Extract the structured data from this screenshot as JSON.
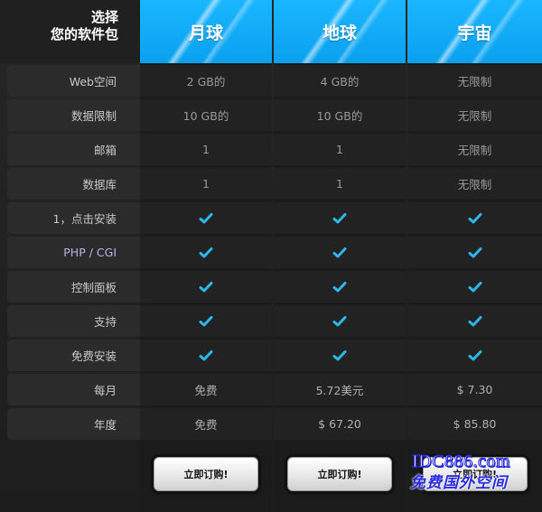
{
  "header": {
    "corner_line1": "选择",
    "corner_line2": "您的软件包"
  },
  "features": [
    "Web空间",
    "数据限制",
    "邮箱",
    "数据库",
    "1，点击安装",
    "PHP / CGI",
    "控制面板",
    "支持",
    "免费安装",
    "每月",
    "年度"
  ],
  "plans": [
    {
      "name": "月球",
      "values": [
        "2 GB的",
        "10 GB的",
        "1",
        "1",
        "✓",
        "✓",
        "✓",
        "✓",
        "✓",
        "免费",
        "免费"
      ],
      "button_label": "立即订购!"
    },
    {
      "name": "地球",
      "values": [
        "4 GB的",
        "10 GB的",
        "1",
        "1",
        "✓",
        "✓",
        "✓",
        "✓",
        "✓",
        "5.72美元",
        "$ 67.20"
      ],
      "button_label": "立即订购!"
    },
    {
      "name": "宇宙",
      "values": [
        "无限制",
        "无限制",
        "无限制",
        "无限制",
        "✓",
        "✓",
        "✓",
        "✓",
        "✓",
        "$ 7.30",
        "$ 85.80"
      ],
      "button_label": "立即订购!"
    }
  ],
  "watermark": {
    "line1": "IDC886.com",
    "line2": "免费国外空间"
  },
  "colors": {
    "header_blue": "#0aa0ee",
    "check_color": "#2bb8ea",
    "background": "#1e1e1e"
  }
}
